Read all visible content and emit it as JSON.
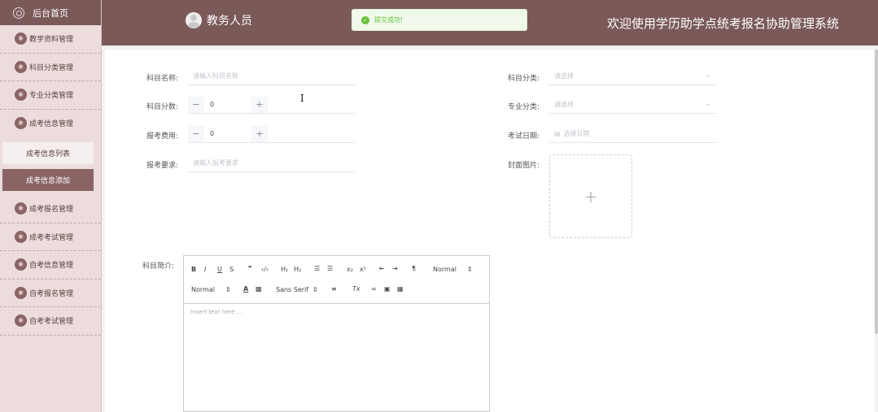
{
  "sidebar": {
    "home": "后台首页",
    "items": [
      {
        "label": "教学资料管理"
      },
      {
        "label": "科目分类管理"
      },
      {
        "label": "专业分类管理"
      },
      {
        "label": "成考信息管理"
      }
    ],
    "subitems": [
      {
        "label": "成考信息列表",
        "active": false
      },
      {
        "label": "成考信息添加",
        "active": true
      }
    ],
    "items2": [
      {
        "label": "成考报名管理"
      },
      {
        "label": "成考考试管理"
      },
      {
        "label": "自考信息管理"
      },
      {
        "label": "自考报名管理"
      },
      {
        "label": "自考考试管理"
      }
    ]
  },
  "header": {
    "user": "教务人员",
    "toast": "提交成功!",
    "title": "欢迎使用学历助学点统考报名协助管理系统"
  },
  "form": {
    "subject_name_label": "科目名称:",
    "subject_name_placeholder": "请输入科目名称",
    "subject_category_label": "科目分类:",
    "subject_category_placeholder": "请选择",
    "subject_score_label": "科目分数:",
    "subject_score_value": "0",
    "major_category_label": "专业分类:",
    "major_category_placeholder": "请选择",
    "fee_label": "报考费用:",
    "fee_value": "0",
    "exam_date_label": "考试日期:",
    "exam_date_placeholder": "选择日期",
    "requirement_label": "报考要求:",
    "requirement_placeholder": "请输入报考要求",
    "cover_label": "封面图片:",
    "intro_label": "科目简介:",
    "editor_placeholder": "Insert text here ...",
    "toolbar": {
      "size_select": "Normal",
      "header_select": "Normal",
      "font_select": "Sans Serif"
    }
  }
}
